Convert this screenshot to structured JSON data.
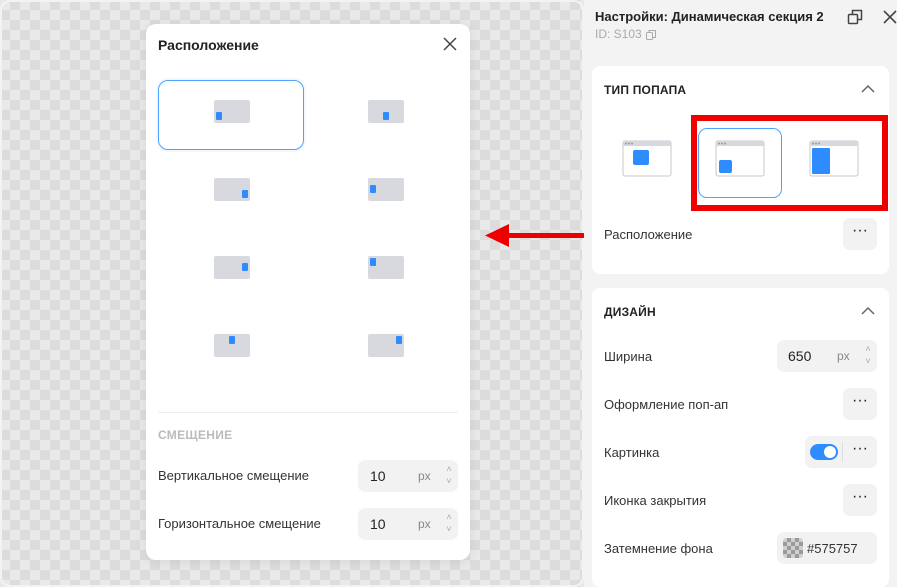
{
  "popup": {
    "title": "Расположение",
    "offset_title": "СМЕЩЕНИЕ",
    "vertical": {
      "label": "Вертикальное смещение",
      "value": "10",
      "unit": "px"
    },
    "horizontal": {
      "label": "Горизонтальное смещение",
      "value": "10",
      "unit": "px"
    },
    "selected_position": "bottom-left"
  },
  "panel": {
    "title": "Настройки: Динамическая секция 2",
    "id_label": "ID: S103",
    "popup_type": {
      "title": "ТИП ПОПАПА",
      "options": [
        "top-left-square",
        "bottom-left-square",
        "sidebar-left"
      ],
      "selected": "bottom-left-square",
      "position_label": "Расположение"
    },
    "design": {
      "title": "ДИЗАЙН",
      "width_label": "Ширина",
      "width_value": "650",
      "width_unit": "px",
      "style_label": "Оформление поп-ап",
      "image_label": "Картинка",
      "image_enabled": true,
      "close_icon_label": "Иконка закрытия",
      "overlay_label": "Затемнение фона",
      "overlay_color": "#575757"
    }
  },
  "colors": {
    "accent": "#2f8cff",
    "highlight": "#ee0000"
  }
}
